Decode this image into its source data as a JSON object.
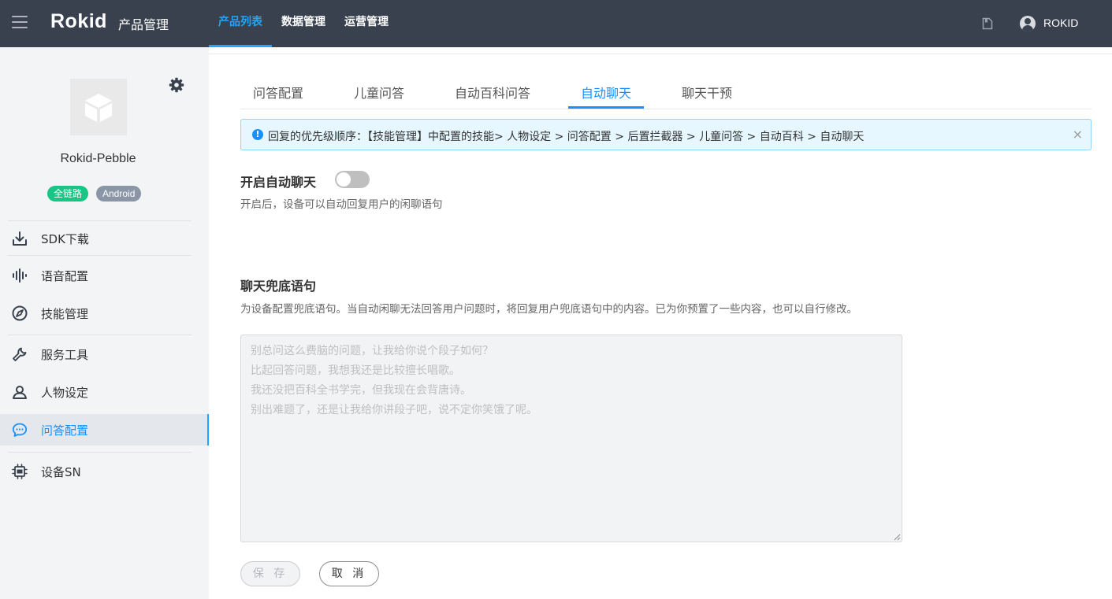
{
  "header": {
    "logo": "Rokid",
    "section_title": "产品管理",
    "nav": [
      {
        "label": "产品列表",
        "active": true
      },
      {
        "label": "数据管理",
        "active": false
      },
      {
        "label": "运营管理",
        "active": false
      }
    ],
    "icons": {
      "menu": "hamburger-icon",
      "doc": "document-icon",
      "user": "user-avatar-icon"
    },
    "user_name": "ROKID"
  },
  "sidebar": {
    "product_name": "Rokid-Pebble",
    "tags": [
      "全链路",
      "Android"
    ],
    "items": [
      {
        "label": "SDK下载",
        "icon": "download-icon"
      },
      {
        "label": "语音配置",
        "icon": "waveform-icon"
      },
      {
        "label": "技能管理",
        "icon": "compass-icon"
      },
      {
        "label": "服务工具",
        "icon": "wrench-icon"
      },
      {
        "label": "人物设定",
        "icon": "persona-icon"
      },
      {
        "label": "问答配置",
        "icon": "chat-bubble-icon",
        "active": true
      },
      {
        "label": "设备SN",
        "icon": "chip-icon"
      }
    ]
  },
  "tabs": [
    {
      "label": "问答配置"
    },
    {
      "label": "儿童问答"
    },
    {
      "label": "自动百科问答"
    },
    {
      "label": "自动聊天",
      "active": true
    },
    {
      "label": "聊天干预"
    }
  ],
  "alert": {
    "text": "回复的优先级顺序：【技能管理】中配置的技能> 人物设定 > 问答配置 > 后置拦截器 > 儿童问答 > 自动百科 > 自动聊天",
    "close": "×"
  },
  "auto_chat": {
    "title": "开启自动聊天",
    "enabled": false,
    "description": "开启后，设备可以自动回复用户的闲聊语句"
  },
  "fallback": {
    "title": "聊天兜底语句",
    "description": "为设备配置兜底语句。当自动闲聊无法回答用户问题时，将回复用户兜底语句中的内容。已为你预置了一些内容，也可以自行修改。",
    "lines": [
      "别总问这么费脑的问题，让我给你说个段子如何？",
      "比起回答问题，我想我还是比较擅长唱歌。",
      "我还没把百科全书学完，但我现在会背唐诗。",
      "别出难题了，还是让我给你讲段子吧，说不定你笑饿了呢。"
    ]
  },
  "buttons": {
    "save": "保 存",
    "cancel": "取 消"
  },
  "colors": {
    "accent": "#1890ff",
    "topbar": "#38414d",
    "tag_green": "#17c585",
    "tag_grey": "#8a96a6"
  }
}
